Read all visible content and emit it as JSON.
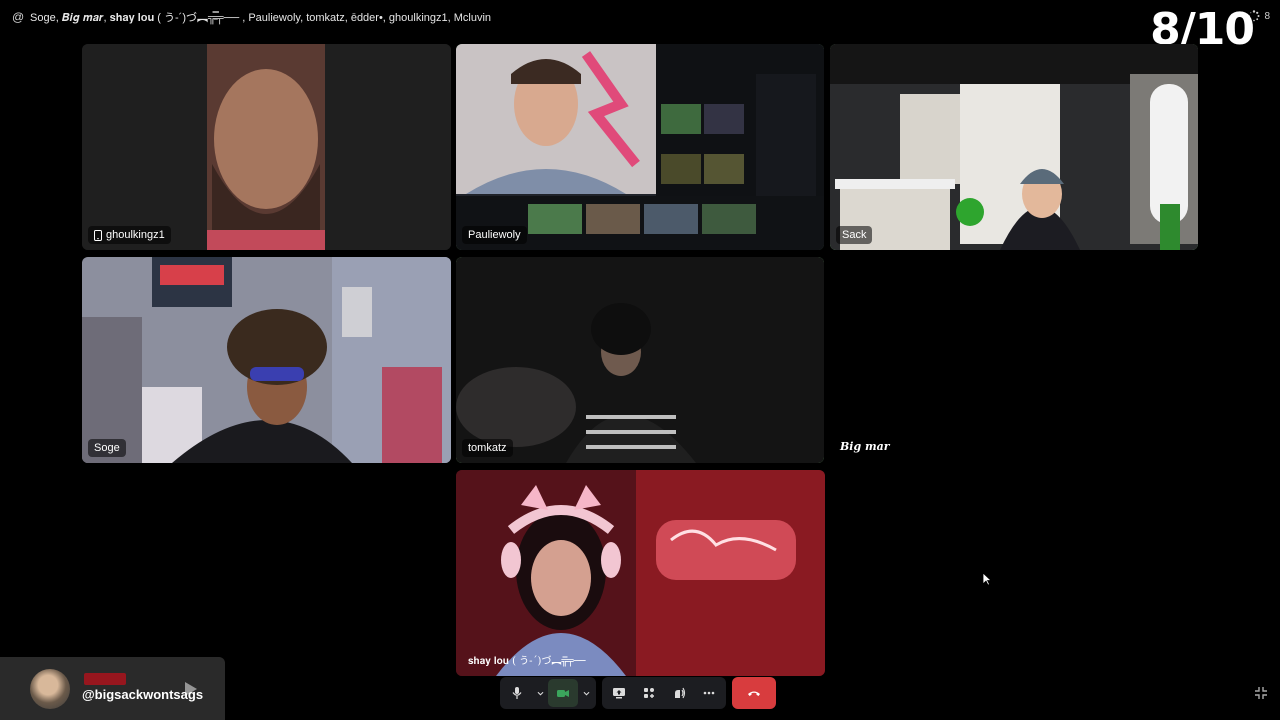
{
  "header": {
    "title": "Soge, 𝑩𝒊𝒈 𝒎𝒂𝒓, 𝐬𝐡𝐚𝐲 𝐥𝐨𝐮 ( う-´)づ︻╦̵̵̿╤── , Pauliewoly, tomkatz, ēdder•, ghoulkingz1, Mcluvin",
    "participant_count": "8",
    "at_symbol": "@"
  },
  "overlay": {
    "counter": "8/10"
  },
  "tiles": [
    {
      "name": "ghoulkingz1",
      "mobile": true
    },
    {
      "name": "Pauliewoly"
    },
    {
      "name": "Sack"
    },
    {
      "name": "Soge"
    },
    {
      "name": "tomkatz"
    },
    {
      "name": "𝐬𝐡𝐚𝐲 𝐥𝐨𝐮 ( う-´)づ︻╦̵̵̿╤──"
    }
  ],
  "audio_only": {
    "label": "𝑩𝒊𝒈 𝒎𝒂𝒓"
  },
  "social": {
    "handle": "@bigsackwontsags"
  },
  "colors": {
    "speaking_border": "#7ac97a",
    "end_call": "#d83c3e",
    "control_bg": "#1c1d21",
    "camera_active": "#3ba55c"
  },
  "icons": [
    "microphone-icon",
    "chevron-down-icon",
    "camera-icon",
    "screen-share-icon",
    "activities-icon",
    "soundboard-icon",
    "more-icon",
    "hang-up-icon",
    "exit-fullscreen-icon",
    "phone-icon"
  ]
}
